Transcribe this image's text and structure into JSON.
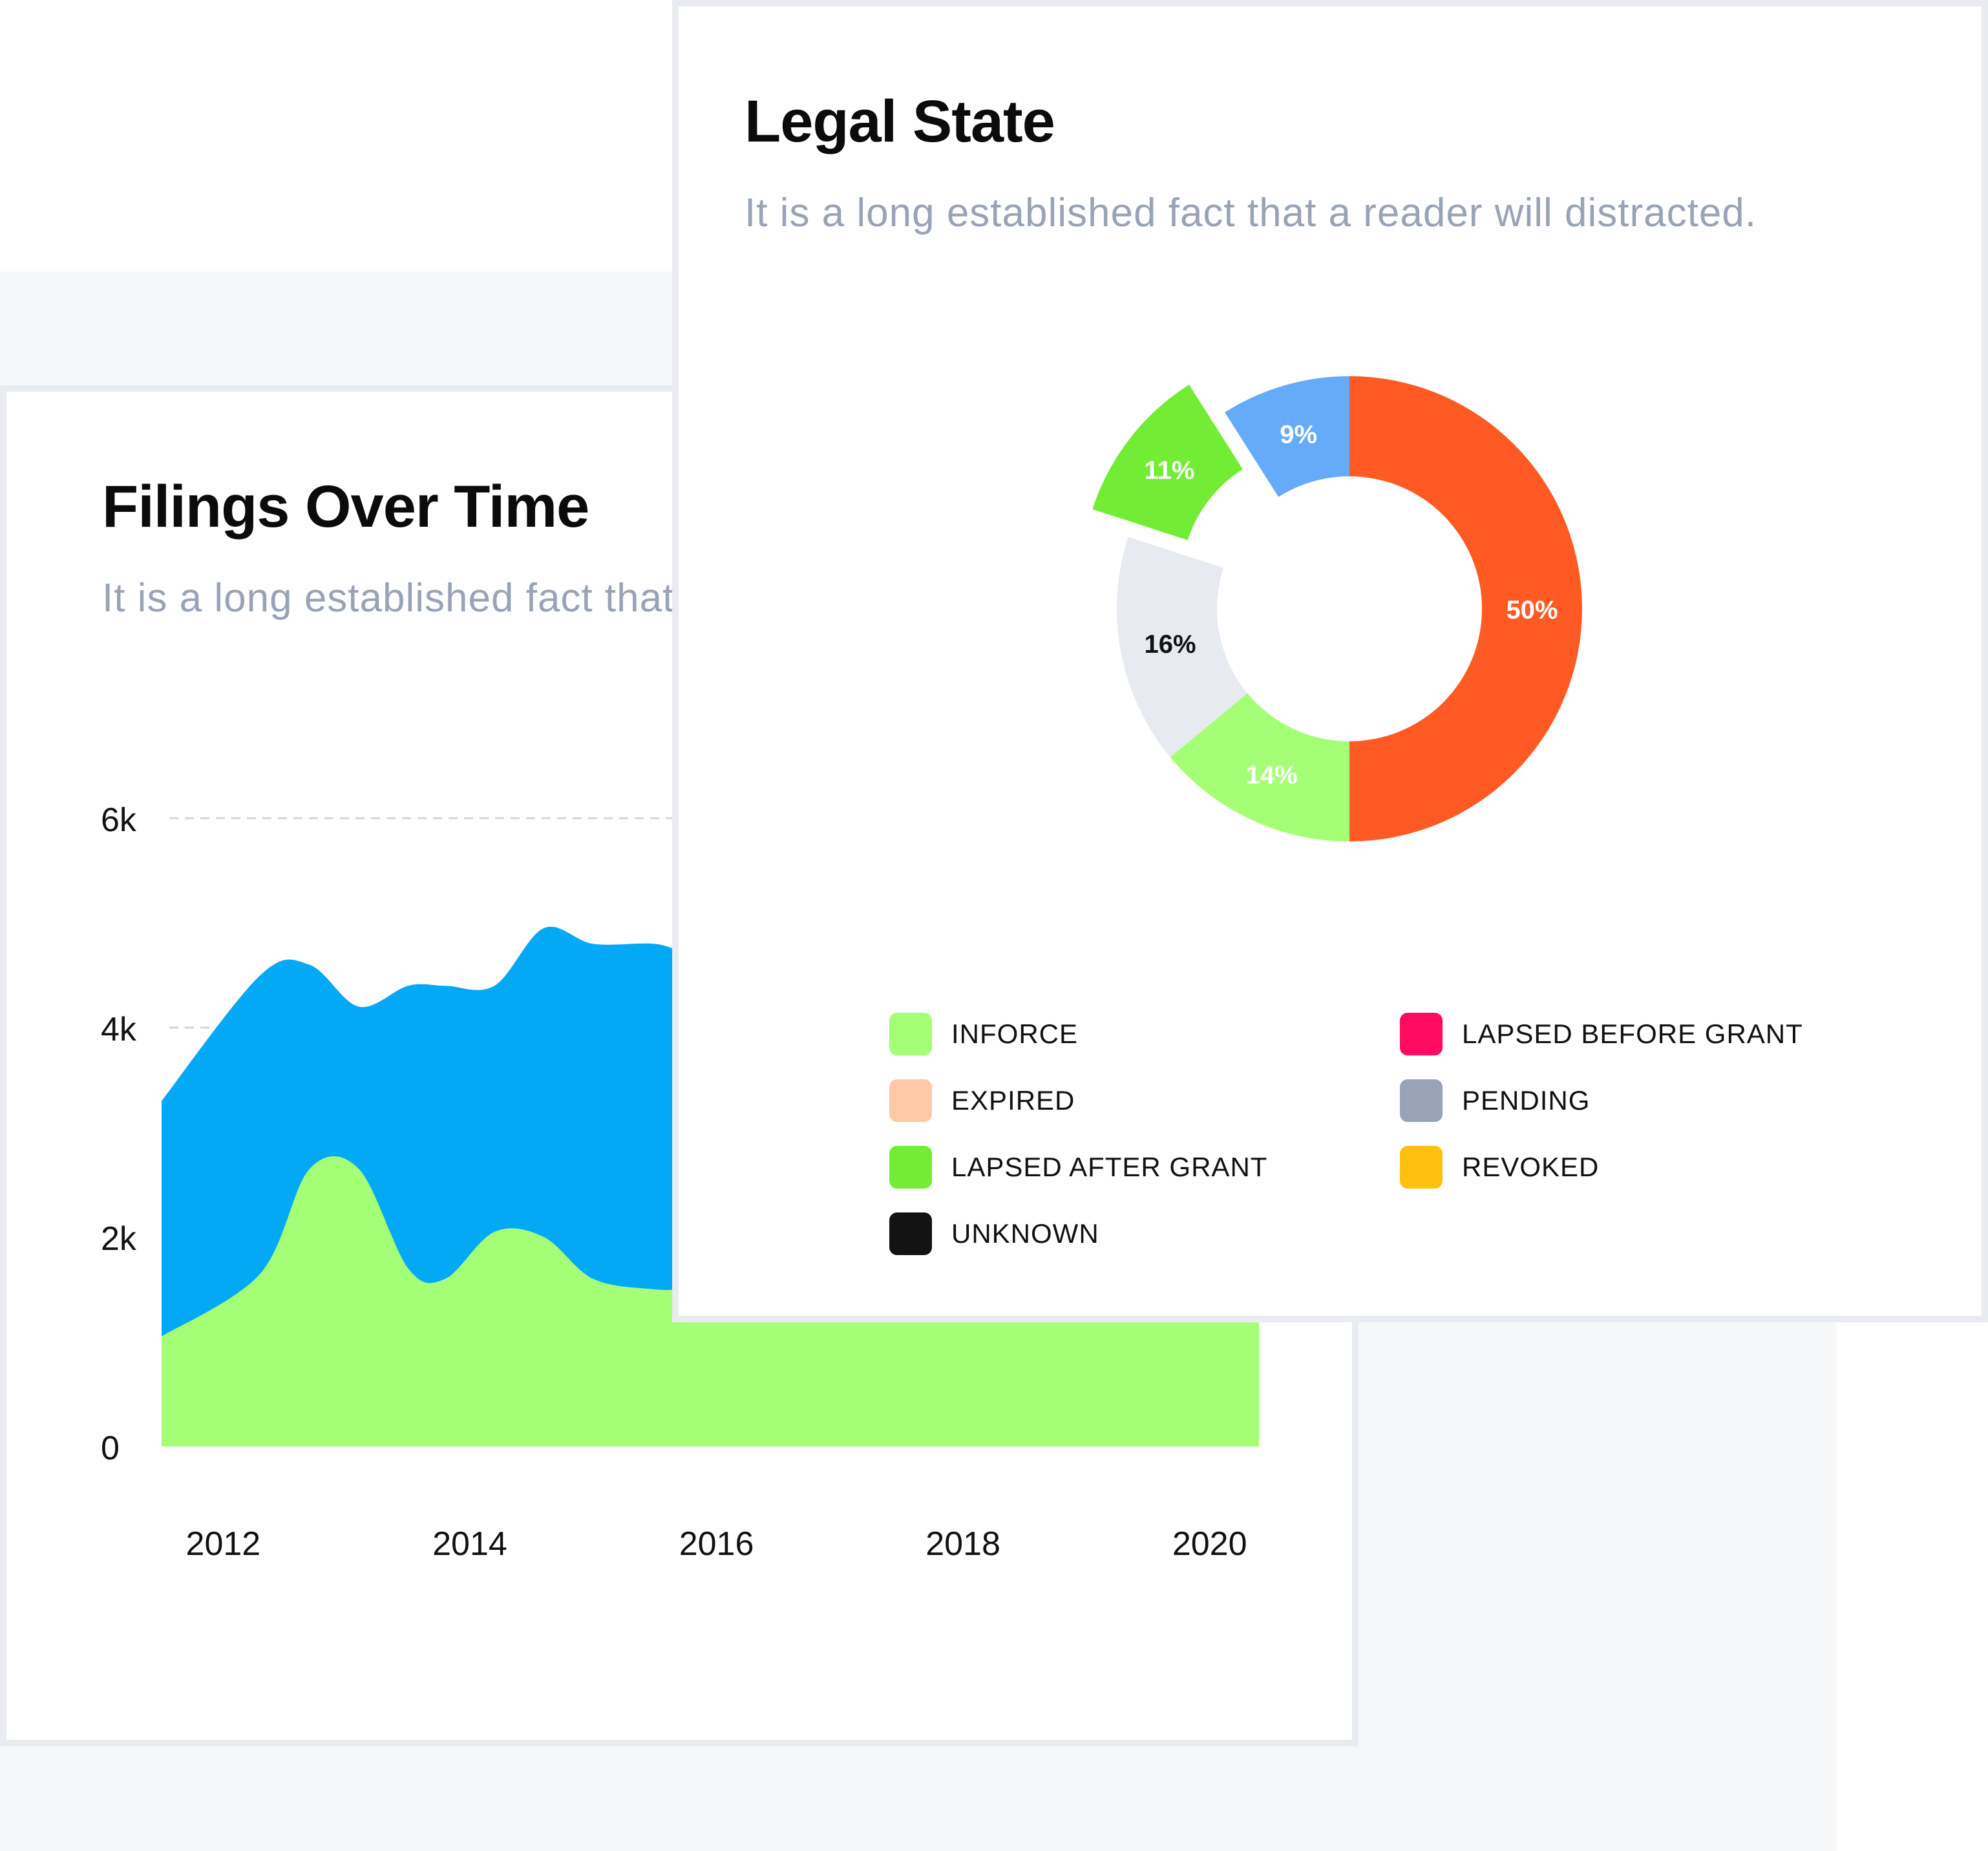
{
  "area_card": {
    "title": "Filings Over Time",
    "subtitle": "It is a long established fact that a reader will distracted."
  },
  "donut_card": {
    "title": "Legal State",
    "subtitle": "It is a long established fact that a reader will distracted."
  },
  "chart_data": [
    {
      "type": "area",
      "title": "Filings Over Time",
      "subtitle": "It is a long established fact that a reader will distracted.",
      "stacked": true,
      "x": [
        2011.5,
        2012.3,
        2012.7,
        2013.1,
        2013.5,
        2013.8,
        2014.2,
        2014.6,
        2015.0,
        2015.5,
        2015.8,
        2016.2,
        2016.6,
        2017.0,
        2017.5,
        2018.0,
        2018.5,
        2019.0,
        2019.5,
        2020.4
      ],
      "series": [
        {
          "color": "#a5ff76",
          "values": [
            1050,
            1650,
            2650,
            2650,
            1700,
            1600,
            2050,
            2000,
            1600,
            1500,
            1500,
            1450,
            1400,
            1380,
            1400,
            1350,
            1380,
            1300,
            1250,
            1250
          ]
        },
        {
          "color": "#04a9f5",
          "values": [
            2250,
            2850,
            1950,
            1550,
            2700,
            2800,
            2350,
            2950,
            3200,
            3300,
            3200,
            3250,
            3300,
            3350,
            3300,
            3350,
            3300,
            3350,
            3300,
            3300
          ]
        }
      ],
      "ylim": [
        0,
        6000
      ],
      "yticks": [
        "0",
        "2k",
        "4k",
        "6k"
      ],
      "xticks": [
        "2012",
        "2014",
        "2016",
        "2018",
        "2020"
      ],
      "grid": true
    },
    {
      "type": "pie",
      "title": "Legal State",
      "subtitle": "It is a long established fact that a reader will distracted.",
      "donut": true,
      "slices": [
        {
          "label": "50%",
          "value": 50,
          "color": "#ff5a24",
          "label_color": "#ffffff"
        },
        {
          "label": "14%",
          "value": 14,
          "color": "#a5ff76",
          "label_color": "#ffffff"
        },
        {
          "label": "16%",
          "value": 16,
          "color": "#e8eaf1",
          "label_color": "#111111"
        },
        {
          "label": "11%",
          "value": 11,
          "color": "#72ec34",
          "label_color": "#ffffff",
          "exploded": true
        },
        {
          "label": "9%",
          "value": 9,
          "color": "#66abf9",
          "label_color": "#ffffff"
        }
      ],
      "legend": [
        {
          "label": "INFORCE",
          "color": "#a5ff76"
        },
        {
          "label": "EXPIRED",
          "color": "#ffc9a7"
        },
        {
          "label": "LAPSED AFTER GRANT",
          "color": "#72ec34"
        },
        {
          "label": "UNKNOWN",
          "color": "#131313"
        },
        {
          "label": "LAPSED BEFORE GRANT",
          "color": "#ff0b5f"
        },
        {
          "label": "PENDING",
          "color": "#98a3b7"
        },
        {
          "label": "REVOKED",
          "color": "#ffc00f"
        }
      ],
      "legend_placement": "bottom"
    }
  ]
}
